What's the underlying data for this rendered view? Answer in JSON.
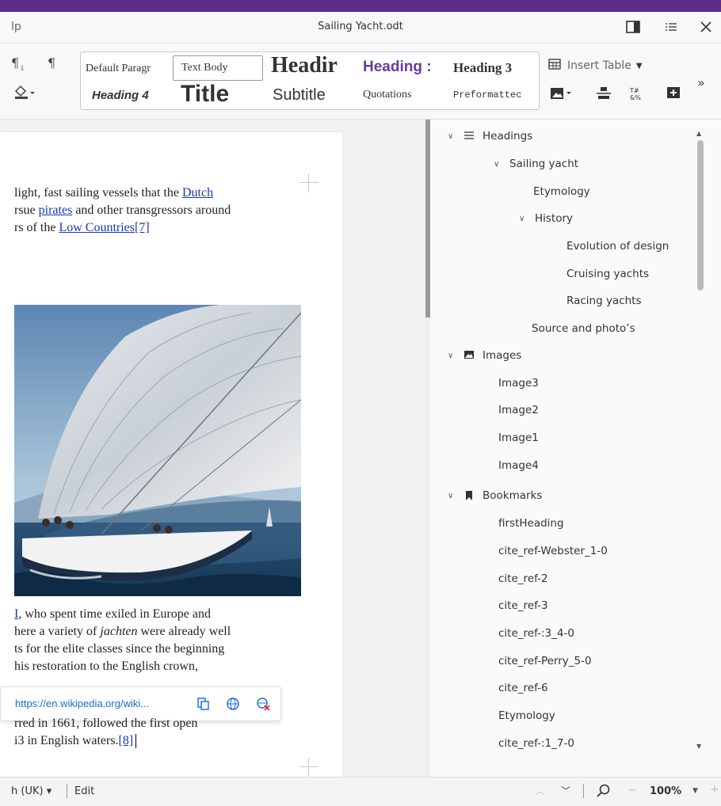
{
  "titlebar": {
    "menu_fragment": "lp",
    "document_title": "Sailing Yacht.odt"
  },
  "styles": {
    "default_paragraph": "Default Paragr",
    "text_body": "Text Body",
    "heading": "Headir",
    "heading2": "Heading :",
    "heading3": "Heading 3",
    "heading4": "Heading 4",
    "title": "Title",
    "subtitle": "Subtitle",
    "quotations": "Quotations",
    "preformatted": "Preformattec"
  },
  "toolbar": {
    "insert_table_label": "Insert Table",
    "more_label": "»"
  },
  "document": {
    "para1": {
      "line1_pre": "light, fast sailing vessels that the ",
      "line1_link": "Dutch",
      "line2_pre": "rsue ",
      "line2_link": "pirates",
      "line2_post": " and other transgressors around",
      "line3_pre": "rs of the ",
      "line3_link": "Low Countries",
      "line3_ref": "[7]"
    },
    "para2": {
      "line1_link": "I",
      "line1_post": ", who spent time exiled in Europe and",
      "line2_pre": "here a variety of ",
      "line2_italic": "jachten",
      "line2_post": " were already well",
      "line3": "ts for the elite classes since the beginning",
      "line4": " his restoration to the English crown,",
      "line5": "rred in 1661, followed   the first open",
      "line6_pre": "i3 in English waters.",
      "line6_ref": "[8]"
    }
  },
  "link_popup": {
    "url": "https://en.wikipedia.org/wiki..."
  },
  "navigator": {
    "headings_label": "Headings",
    "heading_items": [
      "Sailing yacht",
      "Etymology",
      "History",
      "Evolution of design",
      "Cruising yachts",
      "Racing yachts",
      "Source and photo’s"
    ],
    "images_label": "Images",
    "image_items": [
      "Image3",
      "Image2",
      "Image1",
      "Image4"
    ],
    "bookmarks_label": "Bookmarks",
    "bookmark_items": [
      "firstHeading",
      "cite_ref-Webster_1-0",
      "cite_ref-2",
      "cite_ref-3",
      "cite_ref-:3_4-0",
      "cite_ref-Perry_5-0",
      "cite_ref-6",
      "Etymology",
      "cite_ref-:1_7-0"
    ]
  },
  "statusbar": {
    "language": "h (UK) ▾",
    "mode": "Edit",
    "zoom": "100%"
  },
  "colors": {
    "accent_stripe": "#5b2c87",
    "link": "#1a36b3",
    "heading2": "#6a3aa0"
  }
}
